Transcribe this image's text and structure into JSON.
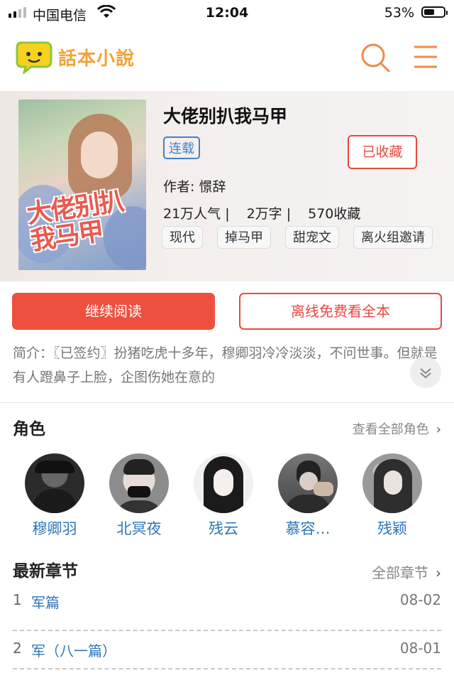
{
  "status_bar": {
    "carrier": "中国电信",
    "time": "12:04",
    "battery": "53%"
  },
  "header": {
    "logo_text": "話本小說",
    "search_icon": "search-icon",
    "menu_icon": "menu-icon"
  },
  "book": {
    "title": "大佬别扒我马甲",
    "cover_text": "大佬别扒我马甲",
    "status": "连载",
    "collect_label": "已收藏",
    "author": "作者: 憬辞",
    "popularity": "21万人气",
    "words": "2万字",
    "collections": "570收藏",
    "tags": [
      "现代",
      "掉马甲",
      "甜宠文",
      "离火组邀请"
    ]
  },
  "actions": {
    "continue_label": "继续阅读",
    "offline_label": "离线免费看全本"
  },
  "intro": {
    "text": "简介：〖已签约〗扮猪吃虎十多年，穆卿羽冷冷淡淡，不问世事。但就是有人蹬鼻子上脸，企图伤她在意的"
  },
  "roles": {
    "title": "角色",
    "more_label": "查看全部角色",
    "items": [
      {
        "name": "穆卿羽"
      },
      {
        "name": "北冥夜"
      },
      {
        "name": "残云"
      },
      {
        "name": "慕容…"
      },
      {
        "name": "残颖"
      }
    ]
  },
  "chapters": {
    "title": "最新章节",
    "more_label": "全部章节",
    "items": [
      {
        "num": "1",
        "title": "军篇",
        "date": "08-02"
      },
      {
        "num": "2",
        "title": "军（八一篇）",
        "date": "08-01"
      }
    ]
  },
  "colors": {
    "accent": "#ee5040",
    "link": "#2f75b8",
    "logo": "#f2a238"
  }
}
